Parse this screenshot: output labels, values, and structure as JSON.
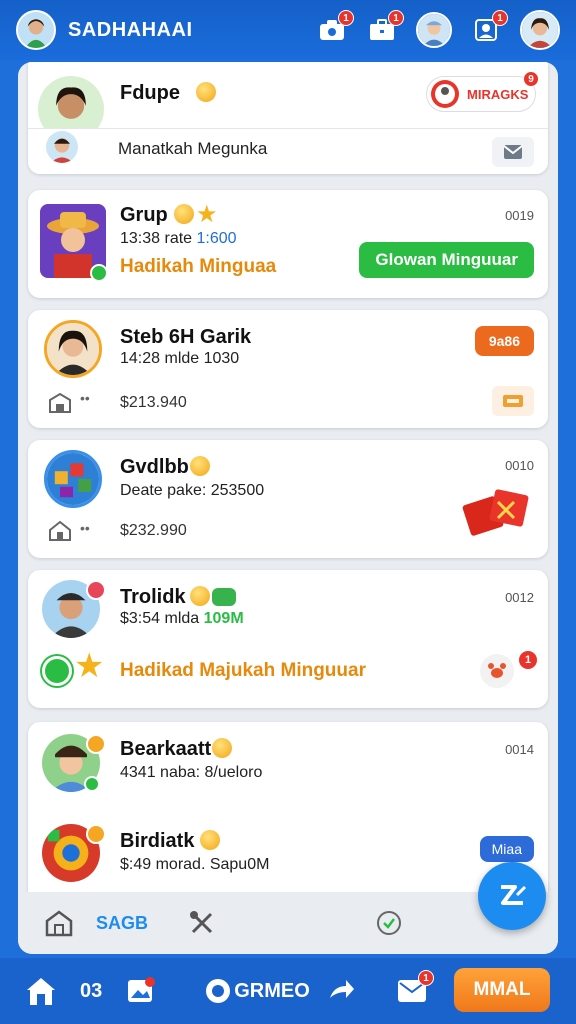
{
  "header": {
    "brand": "SADHAHAAI",
    "notif1": "1",
    "notif2": "1",
    "notif3": "1"
  },
  "feed": {
    "top_card": {
      "name": "Fdupe",
      "badge_label": "MIRAGKS",
      "badge_count": "9",
      "sub_label": "Manatkah Megunka"
    },
    "cards": [
      {
        "name": "Grup",
        "time": "0019",
        "subtitle_prefix": "13:38 rate",
        "subtitle_value": "1:600",
        "promo": "Hadikah Minguaa",
        "button": "Glowan Minguuar"
      },
      {
        "name": "Steb 6H Garik",
        "subtitle": "14:28 mlde 1030",
        "button": "9a86",
        "amount": "$213.940"
      },
      {
        "name": "Gvdlbb",
        "time": "0010",
        "subtitle": "Deate pake: 253500",
        "amount": "$232.990"
      },
      {
        "name": "Trolidk",
        "time": "0012",
        "subtitle_prefix": "$3:54 mlda",
        "subtitle_value": "109M",
        "promo": "Hadikad Majukah Minguuar",
        "notif": "1"
      },
      {
        "name": "Bearkaatt",
        "time": "0014",
        "subtitle": "4341 naba: 8/ueloro"
      },
      {
        "name": "Birdiatk",
        "subtitle": "$:49 morad. Sapu0M",
        "button": "Miaa"
      }
    ]
  },
  "subnav": {
    "label": "SAGB"
  },
  "bottom_nav": {
    "label1": "03",
    "label2": "GRMEO",
    "cta": "MMAL",
    "notif": "1"
  },
  "colors": {
    "primary_blue": "#1a62cc",
    "green": "#2bbd43",
    "orange": "#ec6a1e",
    "promo_orange": "#e78a0c"
  }
}
